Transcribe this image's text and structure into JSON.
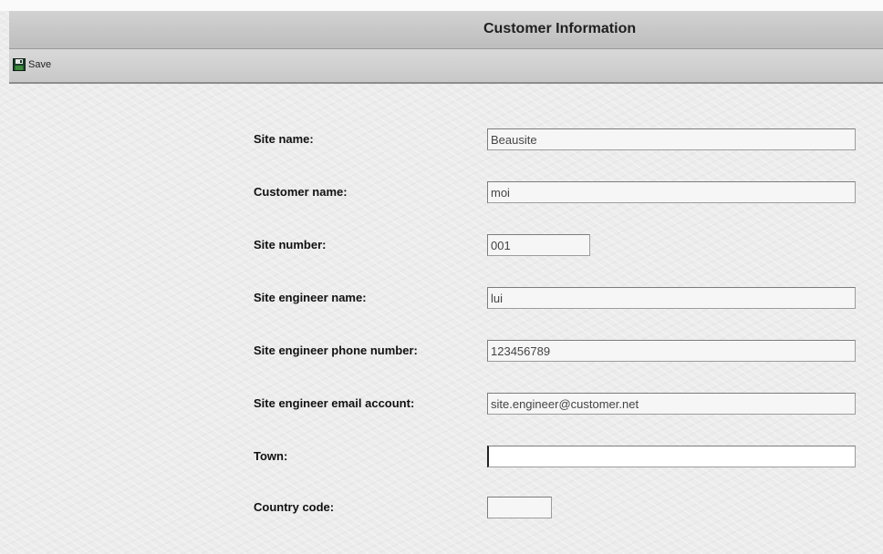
{
  "window": {
    "title": "Customer Information"
  },
  "toolbar": {
    "save_label": "Save",
    "save_icon": "floppy-disk-icon"
  },
  "form": {
    "fields": [
      {
        "label": "Site name:",
        "value": "Beausite"
      },
      {
        "label": "Customer name:",
        "value": "moi"
      },
      {
        "label": "Site number:",
        "value": "001"
      },
      {
        "label": "Site engineer name:",
        "value": "lui"
      },
      {
        "label": "Site engineer phone number:",
        "value": "123456789"
      },
      {
        "label": "Site engineer email account:",
        "value": "site.engineer@customer.net"
      },
      {
        "label": "Town:",
        "value": ""
      },
      {
        "label": "Country code:",
        "value": ""
      }
    ]
  },
  "colors": {
    "header_gray": "#c8c8c8",
    "input_background": "#f6f6f6"
  }
}
